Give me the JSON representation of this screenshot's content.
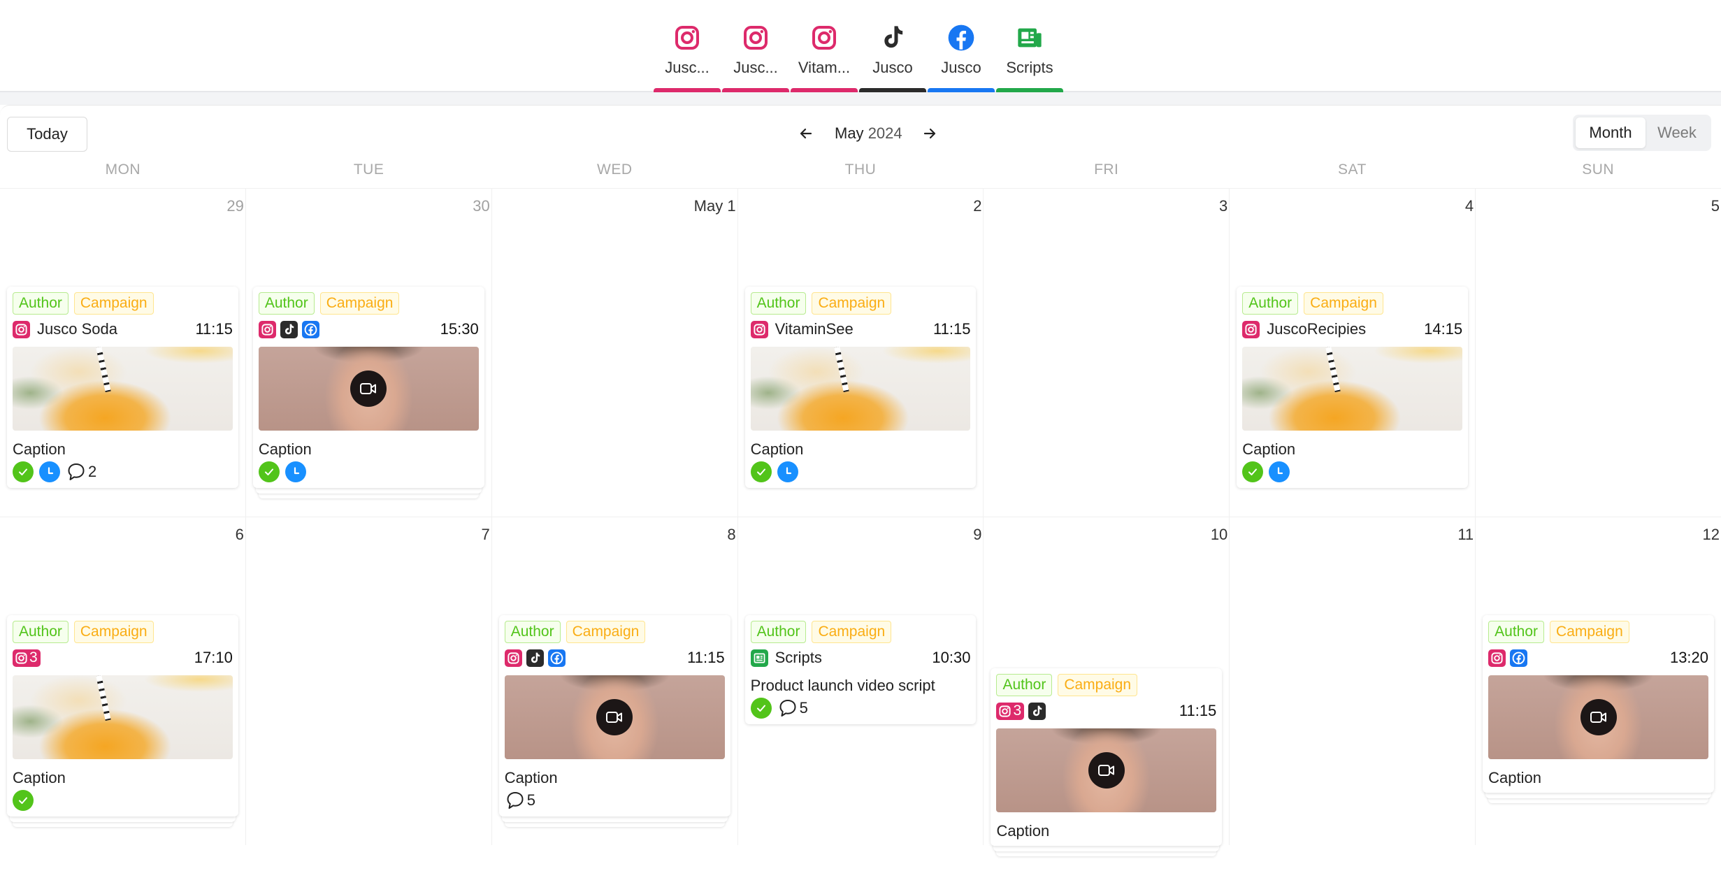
{
  "channels": [
    {
      "label": "Jusc...",
      "platform": "instagram",
      "color": "#dd2a6b"
    },
    {
      "label": "Jusc...",
      "platform": "instagram",
      "color": "#dd2a6b"
    },
    {
      "label": "Vitam...",
      "platform": "instagram",
      "color": "#dd2a6b"
    },
    {
      "label": "Jusco",
      "platform": "tiktok",
      "color": "#2b2b2b"
    },
    {
      "label": "Jusco",
      "platform": "facebook",
      "color": "#1877f2"
    },
    {
      "label": "Scripts",
      "platform": "scripts",
      "color": "#22a84a"
    }
  ],
  "toolbar": {
    "today_label": "Today",
    "month": "May",
    "year": "2024",
    "prev_icon": "arrow-left-icon",
    "next_icon": "arrow-right-icon",
    "views": [
      {
        "label": "Month",
        "active": true
      },
      {
        "label": "Week",
        "active": false
      }
    ]
  },
  "weekdays": [
    "MON",
    "TUE",
    "WED",
    "THU",
    "FRI",
    "SAT",
    "SUN"
  ],
  "weeks": [
    {
      "days": [
        {
          "label": "29",
          "other_month": true
        },
        {
          "label": "30",
          "other_month": true
        },
        {
          "label": "May 1",
          "other_month": false
        },
        {
          "label": "2",
          "other_month": false
        },
        {
          "label": "3",
          "other_month": false
        },
        {
          "label": "4",
          "other_month": false
        },
        {
          "label": "5",
          "other_month": false
        }
      ]
    },
    {
      "days": [
        {
          "label": "6",
          "other_month": false
        },
        {
          "label": "7",
          "other_month": false
        },
        {
          "label": "8",
          "other_month": false
        },
        {
          "label": "9",
          "other_month": false
        },
        {
          "label": "10",
          "other_month": false
        },
        {
          "label": "11",
          "other_month": false
        },
        {
          "label": "12",
          "other_month": false
        }
      ]
    }
  ],
  "tag_labels": {
    "author": "Author",
    "campaign": "Campaign"
  },
  "colors": {
    "instagram": "#dd2a6b",
    "tiktok": "#2b2b2b",
    "facebook": "#1877f2",
    "scripts": "#22a84a",
    "approved": "#52c41a",
    "scheduled": "#1890ff"
  },
  "posts": [
    {
      "week": 0,
      "day": 0,
      "platforms": [
        {
          "p": "instagram"
        }
      ],
      "name": "Jusco Soda",
      "time": "11:15",
      "media": "image",
      "thumb": "juice",
      "caption": "Caption",
      "approved": true,
      "scheduled": true,
      "comments": "2",
      "stacked": false
    },
    {
      "week": 0,
      "day": 1,
      "platforms": [
        {
          "p": "instagram"
        },
        {
          "p": "tiktok"
        },
        {
          "p": "facebook"
        }
      ],
      "name": "",
      "time": "15:30",
      "media": "video",
      "thumb": "face",
      "caption": "Caption",
      "approved": true,
      "scheduled": true,
      "comments": null,
      "stacked": true
    },
    {
      "week": 0,
      "day": 3,
      "platforms": [
        {
          "p": "instagram"
        }
      ],
      "name": "VitaminSee",
      "time": "11:15",
      "media": "image",
      "thumb": "juice",
      "caption": "Caption",
      "approved": true,
      "scheduled": true,
      "comments": null,
      "stacked": false
    },
    {
      "week": 0,
      "day": 5,
      "platforms": [
        {
          "p": "instagram"
        }
      ],
      "name": "JuscoRecipies",
      "time": "14:15",
      "media": "image",
      "thumb": "juice",
      "caption": "Caption",
      "approved": true,
      "scheduled": true,
      "comments": null,
      "stacked": false
    },
    {
      "week": 1,
      "day": 0,
      "platforms": [
        {
          "p": "instagram",
          "count": "3"
        }
      ],
      "name": "",
      "time": "17:10",
      "media": "image",
      "thumb": "juice",
      "caption": "Caption",
      "approved": true,
      "scheduled": false,
      "comments": null,
      "stacked": true
    },
    {
      "week": 1,
      "day": 2,
      "platforms": [
        {
          "p": "instagram"
        },
        {
          "p": "tiktok"
        },
        {
          "p": "facebook"
        }
      ],
      "name": "",
      "time": "11:15",
      "media": "video",
      "thumb": "face",
      "caption": "Caption",
      "approved": false,
      "scheduled": false,
      "comments": "5",
      "stacked": true
    },
    {
      "week": 1,
      "day": 3,
      "platforms": [
        {
          "p": "scripts"
        }
      ],
      "name": "Scripts",
      "time": "10:30",
      "media": "none",
      "thumb": null,
      "script_title": "Product launch video script",
      "caption": null,
      "approved": true,
      "scheduled": false,
      "comments": "5",
      "stacked": false
    },
    {
      "week": 1,
      "day": 4,
      "platforms": [
        {
          "p": "instagram",
          "count": "3"
        },
        {
          "p": "tiktok"
        }
      ],
      "name": "",
      "time": "11:15",
      "media": "video",
      "thumb": "face",
      "caption": "Caption",
      "approved": false,
      "scheduled": false,
      "comments": null,
      "stacked": true,
      "offset": true
    },
    {
      "week": 1,
      "day": 6,
      "platforms": [
        {
          "p": "instagram"
        },
        {
          "p": "facebook"
        }
      ],
      "name": "",
      "time": "13:20",
      "media": "video",
      "thumb": "face",
      "caption": "Caption",
      "approved": false,
      "scheduled": false,
      "comments": null,
      "stacked": true
    }
  ]
}
